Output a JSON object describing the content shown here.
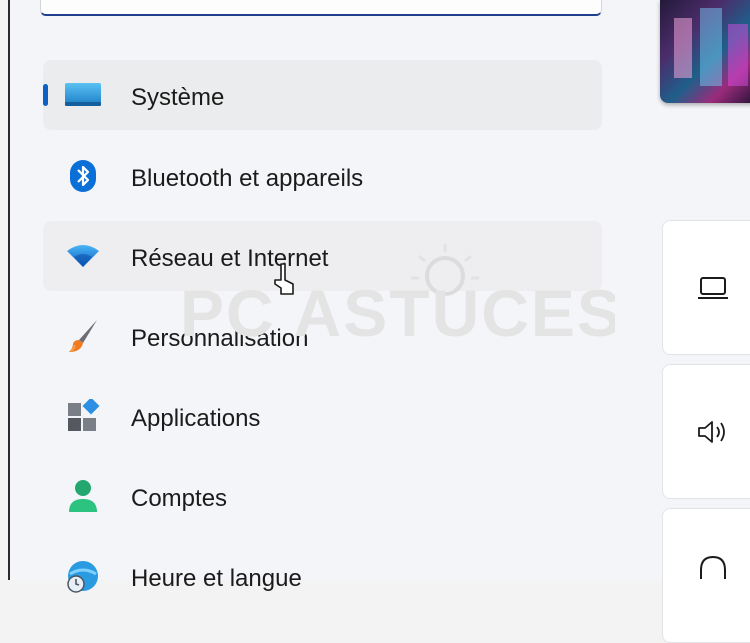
{
  "sidebar": {
    "items": [
      {
        "label": "Système",
        "icon": "monitor-icon"
      },
      {
        "label": "Bluetooth et appareils",
        "icon": "bluetooth-icon"
      },
      {
        "label": "Réseau et Internet",
        "icon": "wifi-icon"
      },
      {
        "label": "Personnalisation",
        "icon": "paintbrush-icon"
      },
      {
        "label": "Applications",
        "icon": "apps-icon"
      },
      {
        "label": "Comptes",
        "icon": "user-icon"
      },
      {
        "label": "Heure et langue",
        "icon": "globe-clock-icon"
      }
    ],
    "selected_index": 0,
    "hover_index": 2
  },
  "right_cards": [
    {
      "icon": "laptop-icon"
    },
    {
      "icon": "speaker-icon"
    },
    {
      "icon": "headphones-icon"
    }
  ],
  "watermark": {
    "text": "PC ASTUCES"
  },
  "colors": {
    "accent": "#0b61c4",
    "selected_bg": "#ebeced",
    "background": "#f4f5f8"
  }
}
